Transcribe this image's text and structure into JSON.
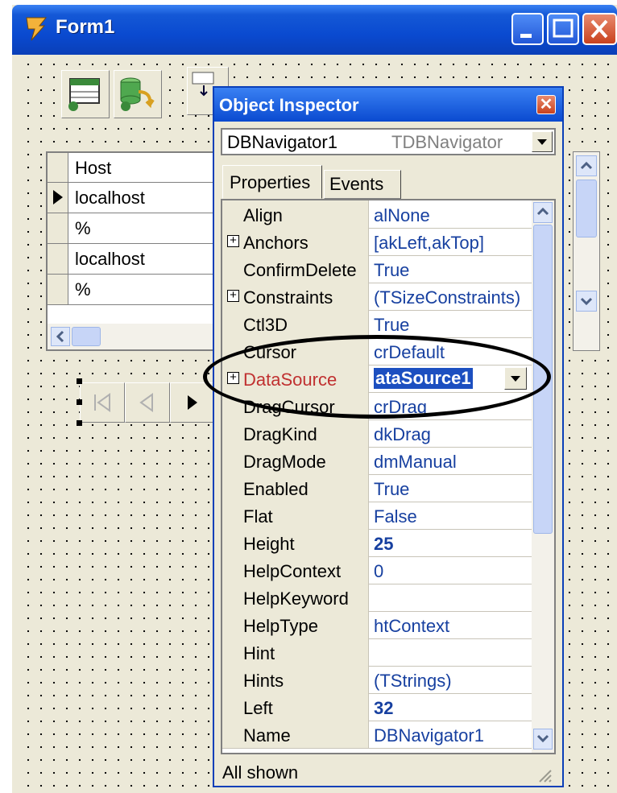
{
  "form1": {
    "title": "Form1"
  },
  "grid": {
    "header": "Host",
    "rows": [
      "localhost",
      "%",
      "localhost",
      "%"
    ]
  },
  "navigator": {
    "buttons": [
      "◂◂",
      "◂",
      "▶",
      "▸"
    ]
  },
  "inspector": {
    "title": "Object Inspector",
    "close_glyph": "✕",
    "selected_component": "DBNavigator1",
    "selected_type": "TDBNavigator",
    "tabs": [
      "Properties",
      "Events"
    ],
    "properties": [
      {
        "name": "Align",
        "value": "alNone"
      },
      {
        "name": "Anchors",
        "value": "[akLeft,akTop]",
        "expandable": true
      },
      {
        "name": "ConfirmDelete",
        "value": "True"
      },
      {
        "name": "Constraints",
        "value": "(TSizeConstraints)",
        "expandable": true
      },
      {
        "name": "Ctl3D",
        "value": "True"
      },
      {
        "name": "Cursor",
        "value": "crDefault"
      },
      {
        "name": "DataSource",
        "value": "ataSource1",
        "expandable": true,
        "selected": true
      },
      {
        "name": "DragCursor",
        "value": "crDrag"
      },
      {
        "name": "DragKind",
        "value": "dkDrag"
      },
      {
        "name": "DragMode",
        "value": "dmManual"
      },
      {
        "name": "Enabled",
        "value": "True"
      },
      {
        "name": "Flat",
        "value": "False"
      },
      {
        "name": "Height",
        "value": "25",
        "bold": true
      },
      {
        "name": "HelpContext",
        "value": "0"
      },
      {
        "name": "HelpKeyword",
        "value": ""
      },
      {
        "name": "HelpType",
        "value": "htContext"
      },
      {
        "name": "Hint",
        "value": ""
      },
      {
        "name": "Hints",
        "value": "(TStrings)"
      },
      {
        "name": "Left",
        "value": "32",
        "bold": true
      },
      {
        "name": "Name",
        "value": "DBNavigator1"
      }
    ],
    "status": "All shown"
  },
  "colors": {
    "titlebar": "#0A4AD0",
    "selection": "#1C4FC0",
    "highlight_name": "#C03030"
  }
}
